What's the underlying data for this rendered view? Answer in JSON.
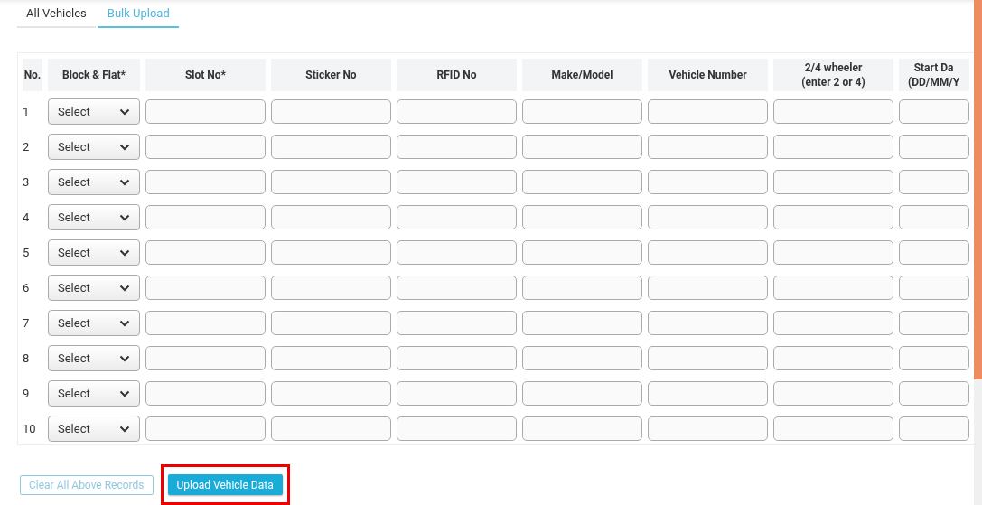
{
  "tabs": [
    {
      "label": "All Vehicles",
      "selected": false
    },
    {
      "label": "Bulk Upload",
      "selected": true
    }
  ],
  "table": {
    "columns": [
      {
        "label": "No.",
        "kind": "number"
      },
      {
        "label": "Block & Flat*",
        "kind": "select"
      },
      {
        "label": "Slot No*",
        "kind": "text"
      },
      {
        "label": "Sticker No",
        "kind": "text"
      },
      {
        "label": "RFID No",
        "kind": "text"
      },
      {
        "label": "Make/Model",
        "kind": "text"
      },
      {
        "label": "Vehicle Number",
        "kind": "text"
      },
      {
        "label": "2/4 wheeler\n(enter 2 or 4)",
        "kind": "text"
      },
      {
        "label": "Start Da\n(DD/MM/Y",
        "kind": "text"
      }
    ],
    "rows": [
      {
        "no": "1",
        "block": "Select"
      },
      {
        "no": "2",
        "block": "Select"
      },
      {
        "no": "3",
        "block": "Select"
      },
      {
        "no": "4",
        "block": "Select"
      },
      {
        "no": "5",
        "block": "Select"
      },
      {
        "no": "6",
        "block": "Select"
      },
      {
        "no": "7",
        "block": "Select"
      },
      {
        "no": "8",
        "block": "Select"
      },
      {
        "no": "9",
        "block": "Select"
      },
      {
        "no": "10",
        "block": "Select"
      }
    ]
  },
  "buttons": {
    "clear": "Clear All Above Records",
    "upload": "Upload Vehicle Data"
  }
}
